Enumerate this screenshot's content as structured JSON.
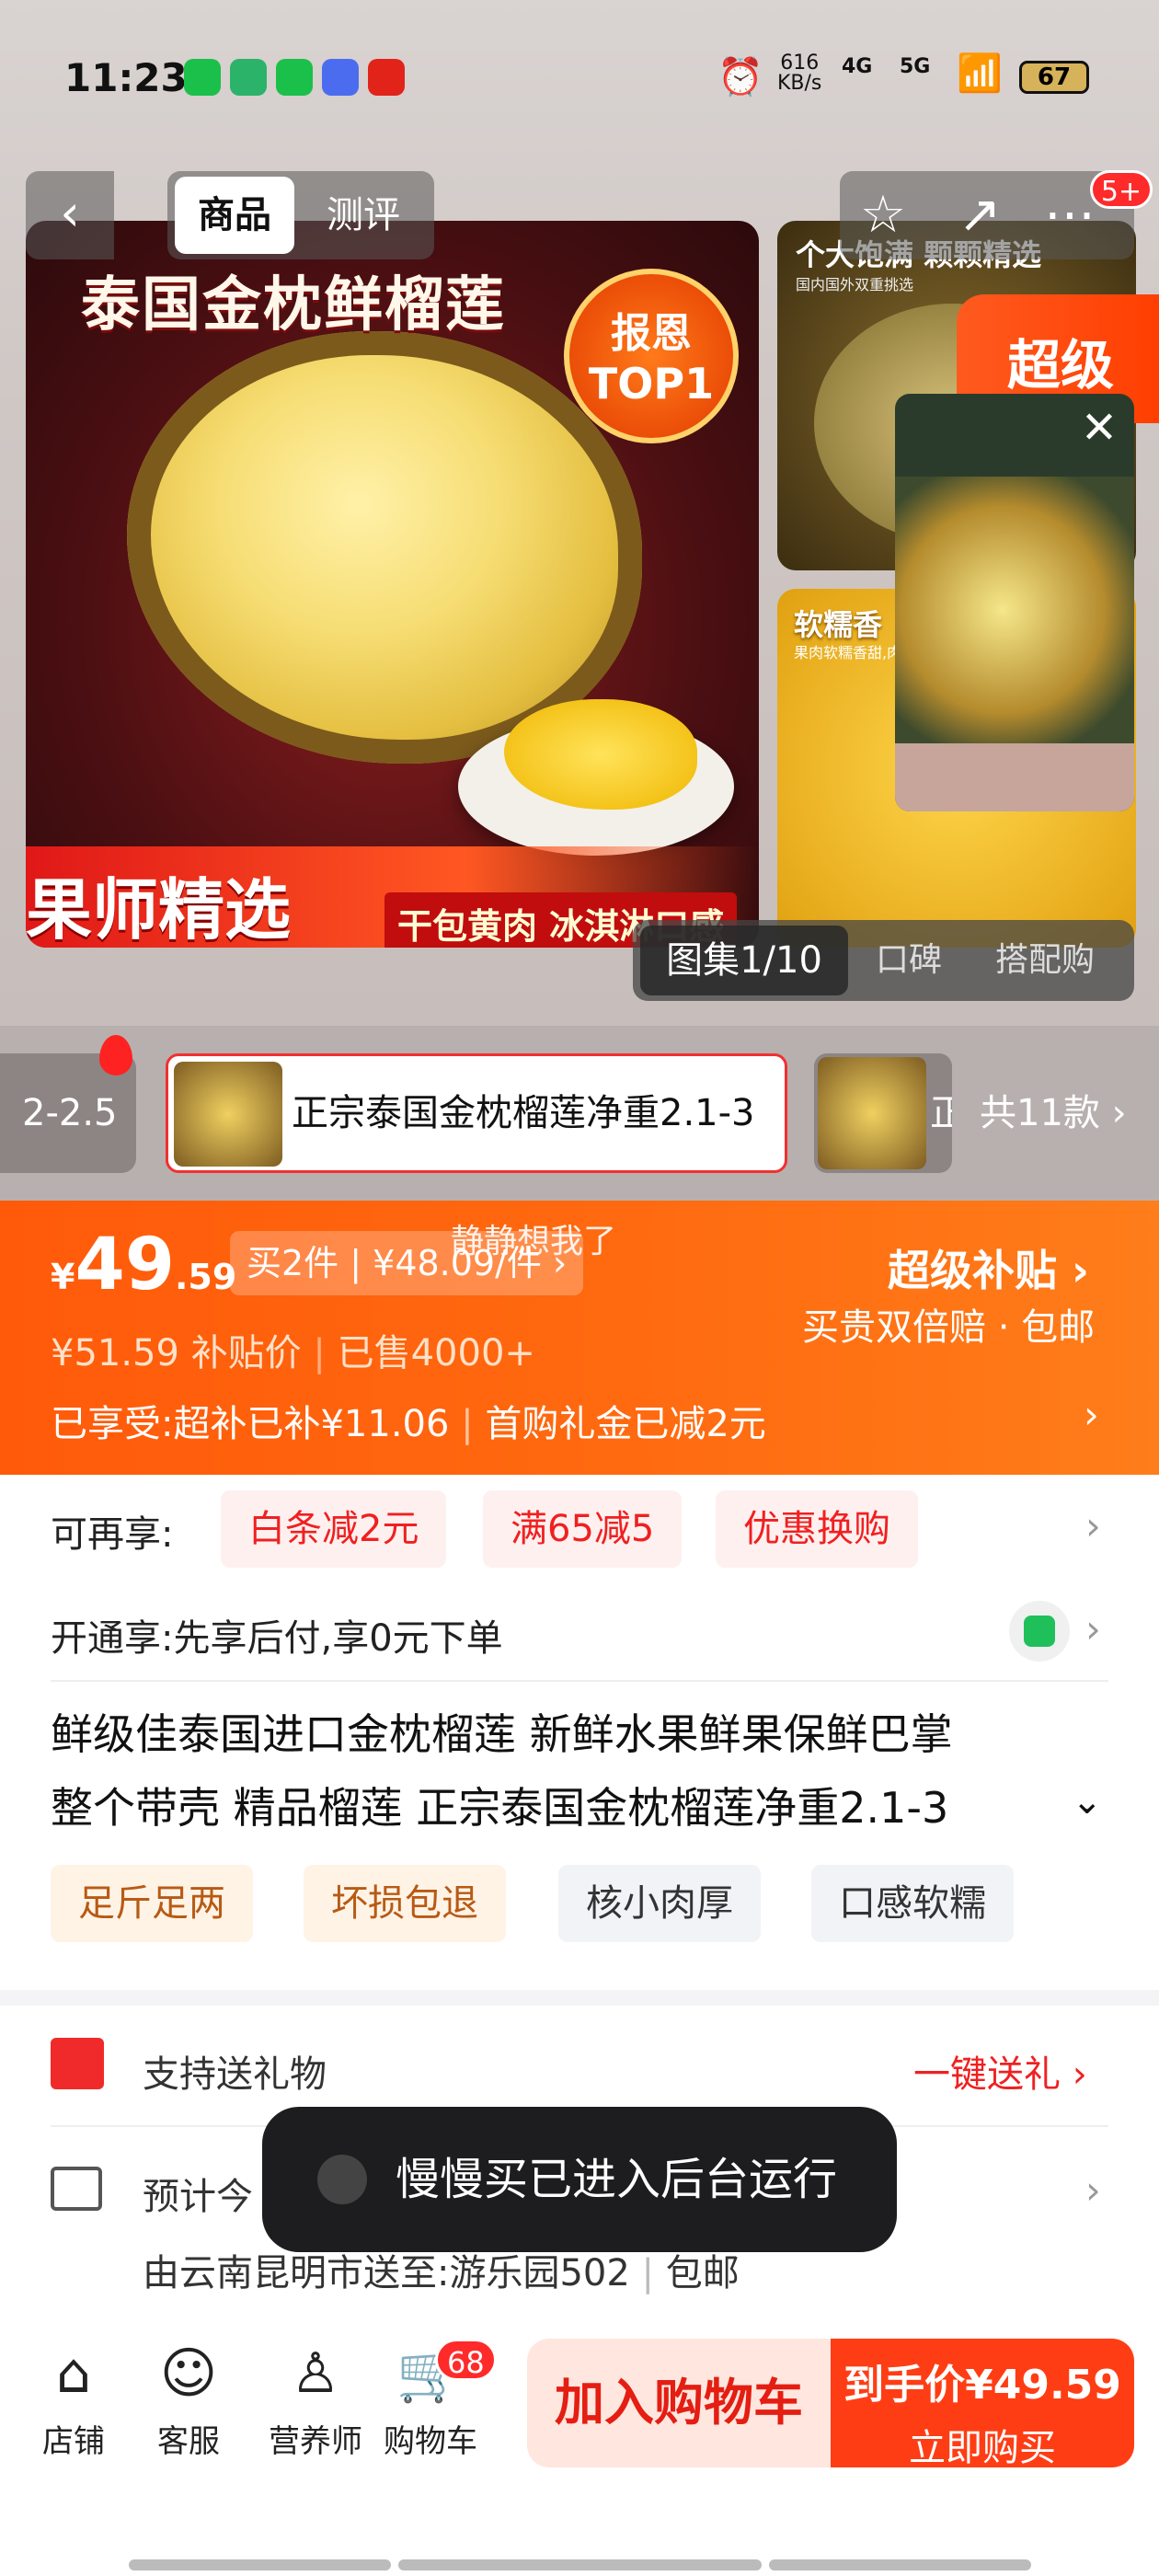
{
  "status_bar": {
    "time": "11:23",
    "net_speed": "616",
    "net_unit": "KB/s",
    "sim1": "4G",
    "sim2": "5G",
    "battery": "67"
  },
  "top_tabs": {
    "product": "商品",
    "review": "测评"
  },
  "cart_badge_top": "5+",
  "hero": {
    "title": "泰国金枕鲜榴莲",
    "badge_line1": "报恩",
    "badge_line2": "TOP1",
    "banner_main": "果师精选",
    "banner_sub": "干包黄肉 冰淇淋口感",
    "side1_title": "个大饱满 颗颗精选",
    "side1_sub": "国内国外双重挑选",
    "side2_title": "软糯香",
    "side2_sub": "果肉软糯香甜,肉厚",
    "super_label": "超级"
  },
  "gallery": {
    "current": "图集1/10",
    "tab2": "口碑",
    "tab3": "搭配购"
  },
  "variants": {
    "left_text": "2-2.5",
    "selected_text": "正宗泰国金枕榴莲净重2.1-3",
    "right_text": "正",
    "total": "共11款 ›"
  },
  "price": {
    "symbol": "¥",
    "integer": "49",
    "decimal": ".59",
    "buy2": "买2件 | ¥48.09/件 ›",
    "watermark": "静静想我了",
    "original": "¥51.59",
    "original_suffix": "补贴价",
    "sold": "已售4000+",
    "enjoyed": "已享受:超补已补¥11.06",
    "gift_cash": "首购礼金已减2元",
    "super_subsidy": "超级补贴 ›",
    "guarantee": "买贵双倍赔 · 包邮"
  },
  "promos": {
    "label": "可再享:",
    "chips": [
      "白条减2元",
      "满65减5",
      "优惠换购"
    ],
    "open_label": "开通享:先享后付,享0元下单"
  },
  "product_title": {
    "line1": "鲜级佳泰国进口金枕榴莲 新鲜水果鲜果保鲜巴掌",
    "line2": "整个带壳  精品榴莲 正宗泰国金枕榴莲净重2.1-3"
  },
  "tags": [
    "足斤足两",
    "坏损包退",
    "核小肉厚",
    "口感软糯"
  ],
  "gift": {
    "label": "支持送礼物",
    "action": "一键送礼 ›"
  },
  "delivery": {
    "label": "预计今",
    "route": "由云南昆明市送至:游乐园502",
    "free": "包邮"
  },
  "toast": "慢慢买已进入后台运行",
  "footer": {
    "shop": "店铺",
    "service": "客服",
    "nutritionist": "营养师",
    "cart": "购物车",
    "cart_count": "68",
    "add_cart": "加入购物车",
    "buy_line1": "到手价¥49.59",
    "buy_line2": "立即购买"
  },
  "colors": {
    "accent": "#ff5a0a",
    "buy": "#ff3d14",
    "promo_red": "#f02020"
  }
}
